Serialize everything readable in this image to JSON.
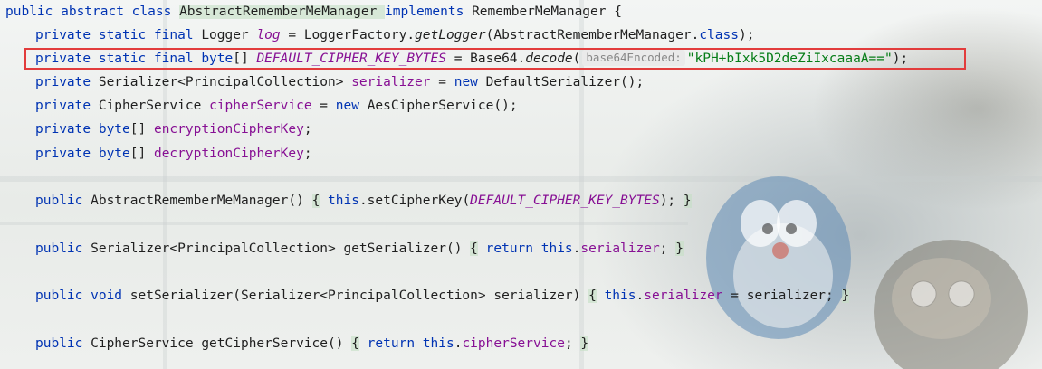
{
  "code": {
    "lines": {
      "l1": {
        "kw1": "public abstract class ",
        "name": "AbstractRememberMeManager ",
        "kw2": "implements ",
        "iface": "RememberMeManager {"
      },
      "l2": {
        "kw": "private static final ",
        "type": "Logger ",
        "field": "log",
        "eq": " = LoggerFactory.",
        "call": "getLogger",
        "arg": "(AbstractRememberMeManager.",
        "cls": "class",
        "end": ");"
      },
      "l3": {
        "kw": "private static final ",
        "type": "byte",
        "arr": "[] ",
        "field": "DEFAULT_CIPHER_KEY_BYTES",
        "eq": " = Base64.",
        "call": "decode",
        "open": "(",
        "hint": "base64Encoded:",
        "str": "\"kPH+bIxk5D2deZiIxcaaaA==\"",
        "end": ");"
      },
      "l4": {
        "kw": "private ",
        "type": "Serializer<PrincipalCollection> ",
        "field": "serializer",
        "eq": " = ",
        "kw2": "new ",
        "val": "DefaultSerializer();"
      },
      "l5": {
        "kw": "private ",
        "type": "CipherService ",
        "field": "cipherService",
        "eq": " = ",
        "kw2": "new ",
        "val": "AesCipherService();"
      },
      "l6": {
        "kw": "private ",
        "type": "byte",
        "arr": "[] ",
        "field": "encryptionCipherKey",
        "end": ";"
      },
      "l7": {
        "kw": "private ",
        "type": "byte",
        "arr": "[] ",
        "field": "decryptionCipherKey",
        "end": ";"
      },
      "l8": {
        "kw": "public ",
        "name": "AbstractRememberMeManager",
        "paren": "() ",
        "lb": "{",
        "sp": " ",
        "kw2": "this",
        "call": ".setCipherKey(",
        "const": "DEFAULT_CIPHER_KEY_BYTES",
        "end": "); ",
        "rb": "}"
      },
      "l9": {
        "kw": "public ",
        "type": "Serializer<PrincipalCollection> ",
        "name": "getSerializer",
        "paren": "() ",
        "lb": "{",
        "kw2": " return this",
        "dot": ".",
        "field": "serializer",
        "semi": "; ",
        "rb": "}"
      },
      "l10": {
        "kw": "public void ",
        "name": "setSerializer",
        "params": "(Serializer<PrincipalCollection> serializer) ",
        "lb": "{",
        "kw2": " this",
        "dot": ".",
        "field": "serializer",
        "rest": " = serializer; ",
        "rb": "}"
      },
      "l11": {
        "kw": "public ",
        "type": "CipherService ",
        "name": "getCipherService",
        "paren": "() ",
        "lb": "{",
        "kw2": " return this",
        "dot": ".",
        "field": "cipherService",
        "semi": "; ",
        "rb": "}"
      }
    }
  },
  "colors": {
    "keyword": "#0033b3",
    "field": "#871094",
    "string": "#067d17",
    "highlight_box": "#e23c3c"
  }
}
